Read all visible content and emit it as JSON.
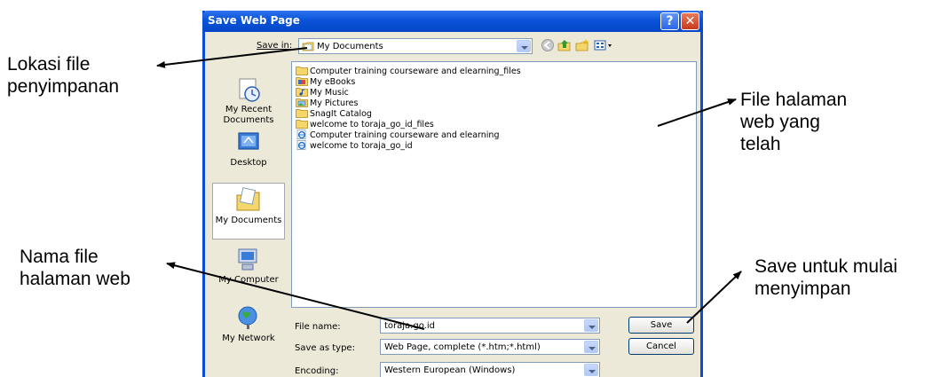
{
  "callouts": {
    "location": [
      "Lokasi file",
      "penyimpanan"
    ],
    "web_files": [
      "File halaman",
      "web yang",
      "telah"
    ],
    "file_name": [
      "Nama file",
      "halaman web"
    ],
    "save": [
      "Save untuk mulai",
      "menyimpan"
    ]
  },
  "dialog": {
    "title": "Save Web Page",
    "help": "?",
    "close": "✕",
    "save_in_label": "Save in:",
    "save_in_value": "My Documents",
    "places": [
      "My Recent Documents",
      "Desktop",
      "My Documents",
      "My Computer",
      "My Network"
    ],
    "files": [
      {
        "name": "Computer training courseware and elearning_files",
        "icon": "folder-icon"
      },
      {
        "name": "My eBooks",
        "icon": "folder-books-icon"
      },
      {
        "name": "My Music",
        "icon": "folder-music-icon"
      },
      {
        "name": "My Pictures",
        "icon": "folder-pictures-icon"
      },
      {
        "name": "SnagIt Catalog",
        "icon": "folder-icon"
      },
      {
        "name": "welcome to toraja_go_id_files",
        "icon": "folder-icon"
      },
      {
        "name": "Computer training courseware and elearning",
        "icon": "ie-page-icon"
      },
      {
        "name": "welcome to toraja_go_id",
        "icon": "ie-page-icon"
      }
    ],
    "file_name_label": "File name:",
    "file_name_value": "toraja.go.id",
    "save_as_type_label": "Save as type:",
    "save_as_type_value": "Web Page, complete (*.htm;*.html)",
    "encoding_label": "Encoding:",
    "encoding_value": "Western European (Windows)",
    "save_button": "Save",
    "cancel_button": "Cancel"
  },
  "colors": {
    "titlebar": "#0a53d8",
    "dialog_bg": "#ece9d8",
    "folder": "#f5d66b"
  }
}
